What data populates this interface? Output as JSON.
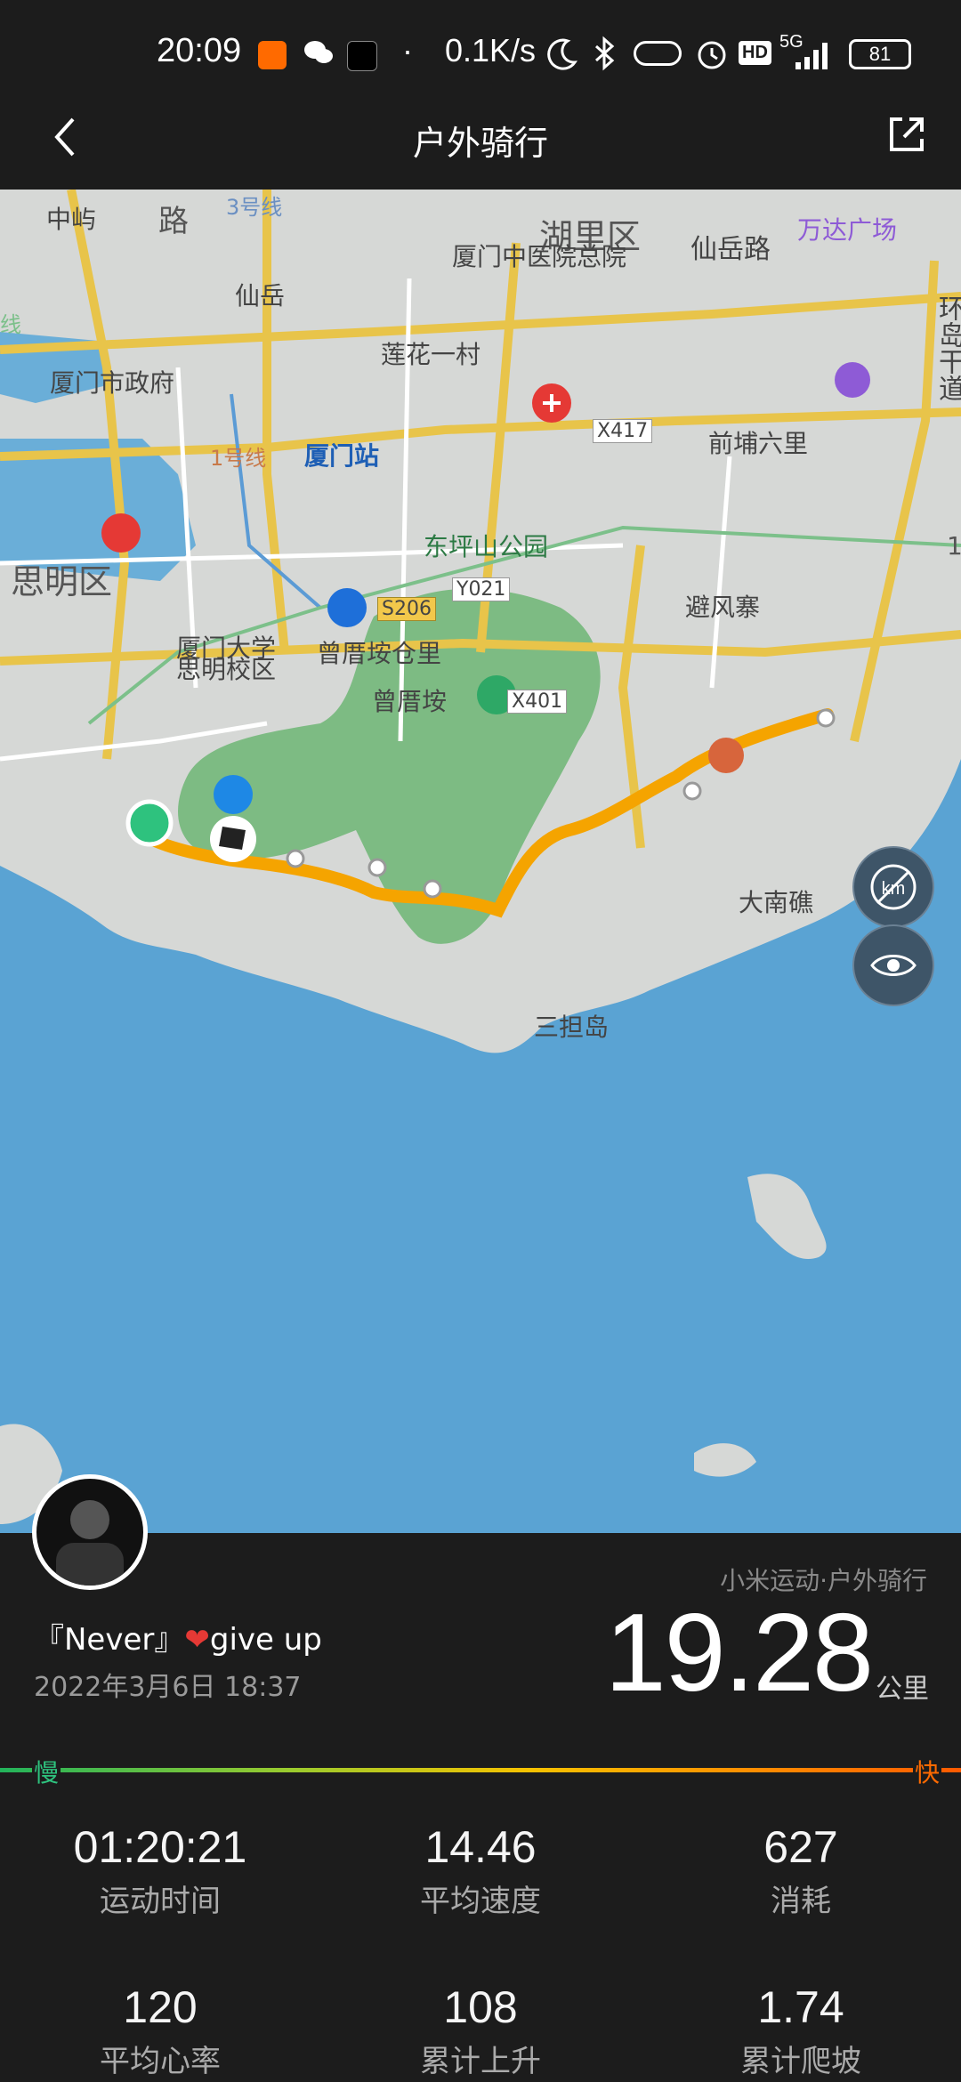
{
  "status_bar": {
    "time": "20:09",
    "net_speed": "0.1K/s",
    "hd": "HD",
    "network": "5G",
    "battery": "81"
  },
  "header": {
    "title": "户外骑行",
    "back_icon": "chevron-left-icon",
    "share_icon": "share-icon"
  },
  "map": {
    "labels": {
      "road1": "路",
      "district_huli": "湖里区",
      "zhongyu": "中屿",
      "line3": "3号线",
      "hospital": "厦门中医院总院",
      "xianyue_road": "仙岳路",
      "wanda": "万达广场",
      "xianyue": "仙岳",
      "line_left": "线",
      "huandao": "环岛干道",
      "lianhua": "莲花一村",
      "gov": "厦门市政府",
      "x417": "X417",
      "qianpu": "前埔六里",
      "line1": "1号线",
      "station": "厦门站",
      "park": "东坪山公园",
      "siming": "思明区",
      "y021": "Y021",
      "s206": "S206",
      "bifengzhai": "避风寨",
      "xiamen_univ": "厦门大学",
      "siming_campus": "思明校区",
      "zengcuoan_cangli": "曾厝垵仓里",
      "zengcuoan": "曾厝垵",
      "x401": "X401",
      "danan": "大南礁",
      "sandan": "三担岛",
      "right_edge": "1"
    },
    "colors": {
      "route_slow": "#f5b800",
      "route_fast": "#ff7a00",
      "water": "#5aa3d3",
      "land": "#d6d8d6",
      "park": "#7dbb83"
    }
  },
  "activity": {
    "app": "小米运动·户外骑行",
    "user": "『Never』",
    "heart": "❤",
    "slogan": "give up",
    "datetime": "2022年3月6日 18:37",
    "distance": "19.28",
    "unit": "公里",
    "speed_slow": "慢",
    "speed_fast": "快"
  },
  "stats": [
    {
      "value": "01:20:21",
      "label": "运动时间"
    },
    {
      "value": "14.46",
      "label": "平均速度"
    },
    {
      "value": "627",
      "label": "消耗"
    },
    {
      "value": "120",
      "label": "平均心率"
    },
    {
      "value": "108",
      "label": "累计上升"
    },
    {
      "value": "1.74",
      "label": "累计爬坡"
    }
  ]
}
